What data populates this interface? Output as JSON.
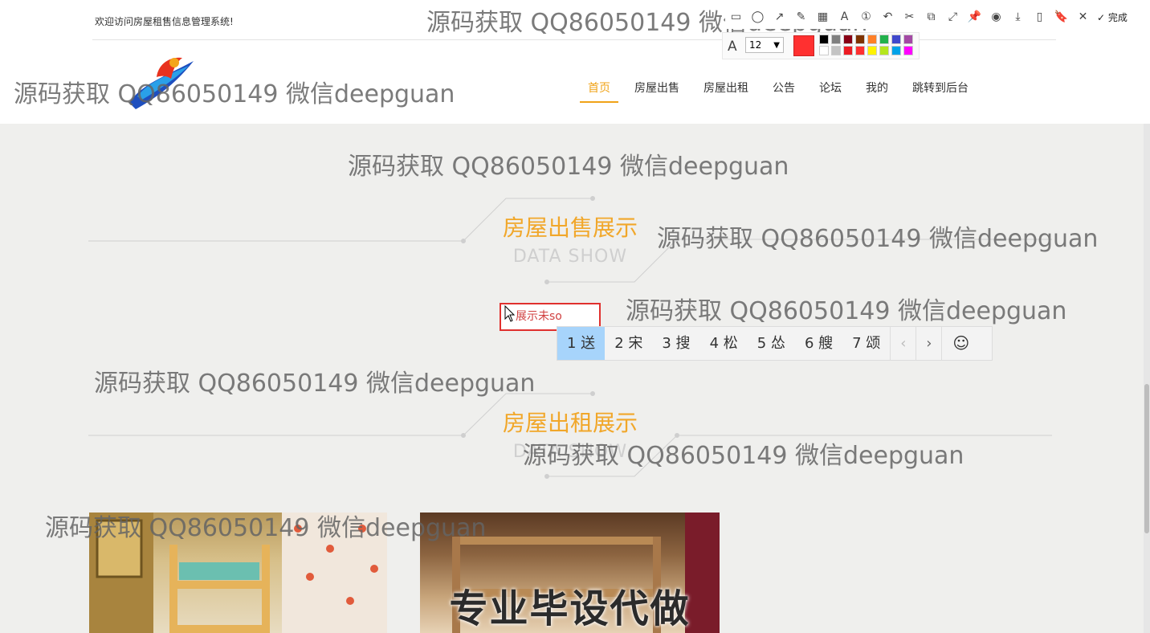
{
  "header": {
    "welcome": "欢迎访问房屋租售信息管理系统!",
    "nav": [
      {
        "label": "首页",
        "active": true
      },
      {
        "label": "房屋出售"
      },
      {
        "label": "房屋出租"
      },
      {
        "label": "公告"
      },
      {
        "label": "论坛"
      },
      {
        "label": "我的"
      },
      {
        "label": "跳转到后台"
      }
    ]
  },
  "sections": [
    {
      "title": "房屋出售展示",
      "subtitle": "DATA SHOW"
    },
    {
      "title": "房屋出租展示",
      "subtitle": "DATA SHOW"
    }
  ],
  "empty_message": "展示未so",
  "ime": {
    "candidates": [
      "1 送",
      "2 宋",
      "3 搜",
      "4 松",
      "5 怂",
      "6 艘",
      "7 颂"
    ],
    "prev": "‹",
    "next": "›",
    "emoji": "☺"
  },
  "images": [
    {
      "name": "bunk-bed-photo"
    },
    {
      "name": "bunk-bed-photo-2",
      "overlay_text": "专业毕设代做"
    }
  ],
  "watermark": "源码获取 QQ86050149 微信deepguan",
  "screenshot_toolbar": {
    "tools": [
      "▭",
      "◯",
      "↗",
      "✎",
      "▦",
      "A",
      "①",
      "↶",
      "✂",
      "⧉",
      "⤢",
      "📌",
      "◉",
      "⤓",
      "▯",
      "🔖",
      "✕"
    ],
    "done_label": "完成",
    "font_icon": "A",
    "font_size": "12",
    "current_color": "#ff3030",
    "palette": [
      "#000000",
      "#7f7f7f",
      "#880015",
      "#7f3300",
      "#ff7f27",
      "#22b14c",
      "#3f48cc",
      "#a349a4",
      "#ffffff",
      "#c3c3c3",
      "#ed1c24",
      "#ff3030",
      "#fff200",
      "#b5e61d",
      "#00a2e8",
      "#ff00ff"
    ]
  },
  "colors": {
    "accent": "#f0a318",
    "page_bg": "#efefed"
  }
}
